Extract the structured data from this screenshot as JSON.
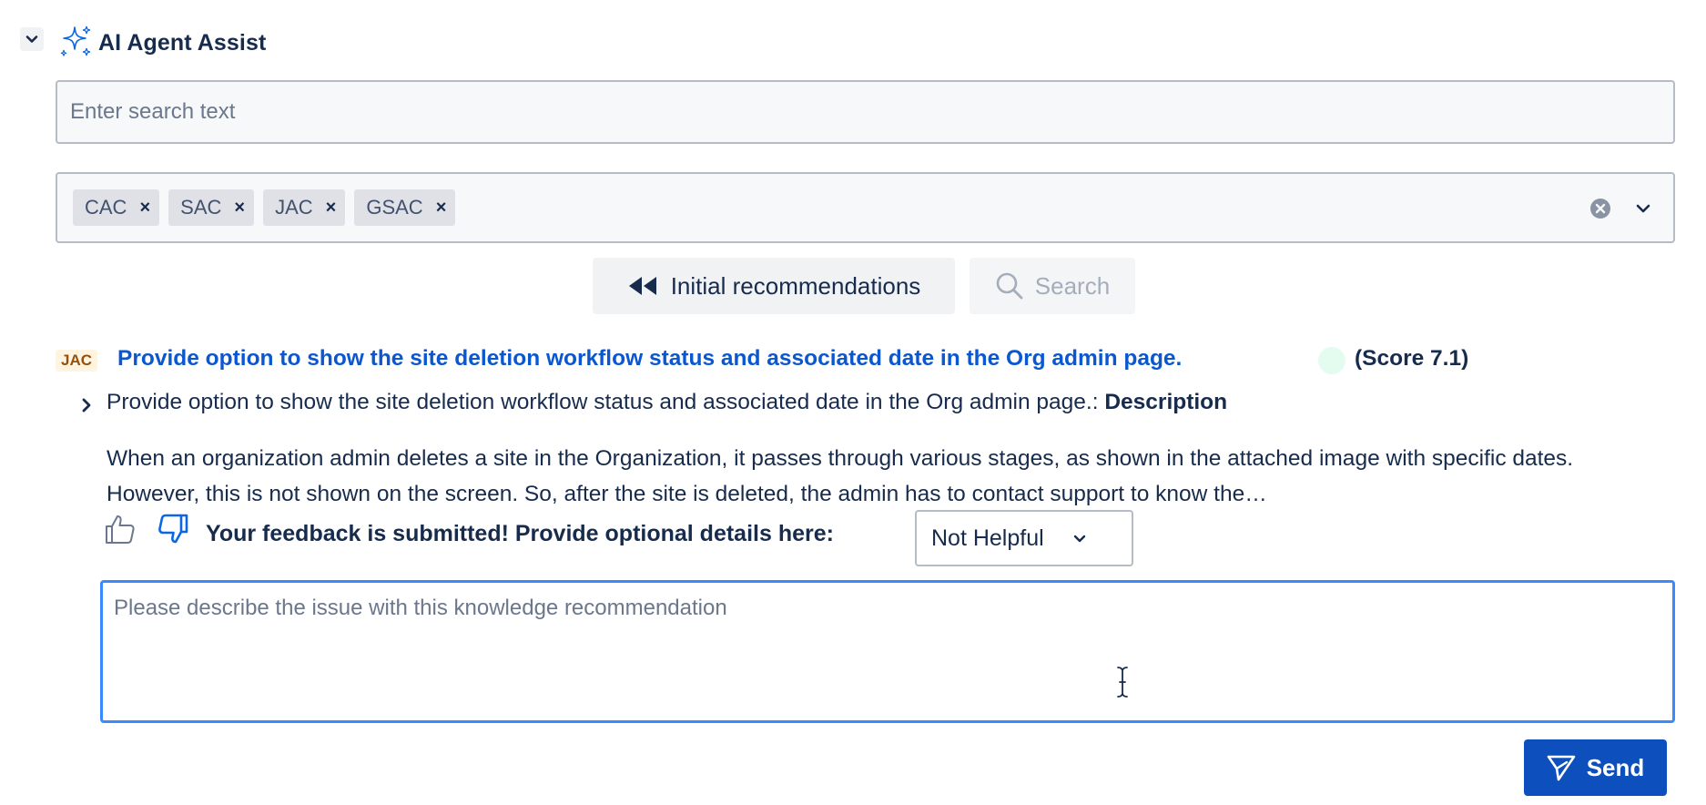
{
  "header": {
    "title": "AI Agent Assist"
  },
  "search": {
    "placeholder": "Enter search text",
    "value": ""
  },
  "filters": {
    "tags": [
      "CAC",
      "SAC",
      "JAC",
      "GSAC"
    ],
    "remove_symbol": "×"
  },
  "actions": {
    "initial_label": "Initial recommendations",
    "search_label": "Search"
  },
  "result": {
    "source": "JAC",
    "title": "Provide option to show the site deletion workflow status and associated date in the Org admin page.",
    "score": "(Score 7.1)",
    "summary_prefix": "Provide option to show the site deletion workflow status and associated date in the Org admin page.: ",
    "summary_label": "Description",
    "description": "When an organization admin deletes a site in the Organization, it passes through various stages, as shown in the attached image with specific dates. However, this is not shown on the screen. So, after the site is deleted, the admin has to contact support to know the…"
  },
  "feedback": {
    "message": "Your feedback is submitted! Provide optional details here:",
    "selected_option": "Not Helpful",
    "textarea_placeholder": "Please describe the issue with this knowledge recommendation",
    "send_label": "Send"
  },
  "colors": {
    "link": "#0b57d0",
    "primary_button": "#0c4fbd",
    "focus_border": "#388bff",
    "score_dot": "#e3fcef",
    "source_badge_bg": "#fff4e0",
    "source_badge_text": "#974f0c"
  }
}
